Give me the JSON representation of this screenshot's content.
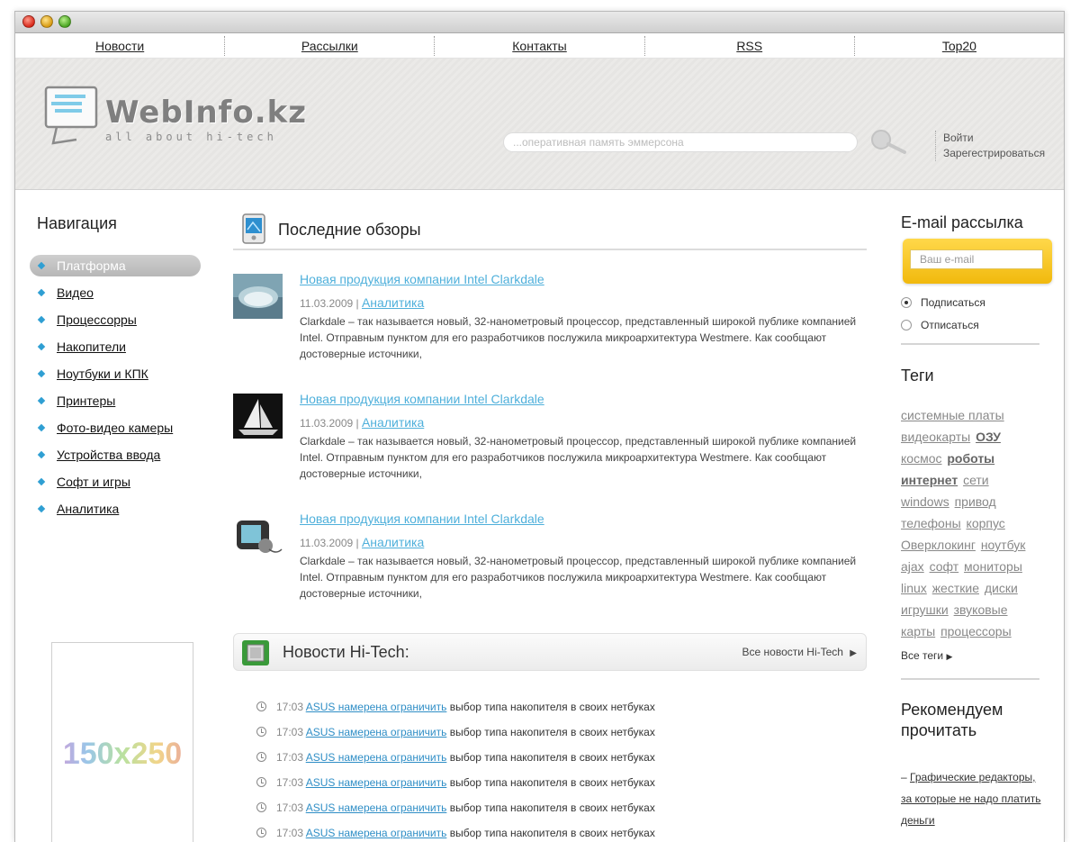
{
  "topnav": {
    "items": [
      "Новости",
      "Рассылки",
      "Контакты",
      "RSS",
      "Top20"
    ]
  },
  "header": {
    "logo_text": "WebInfo.kz",
    "logo_tagline": "all about hi-tech",
    "search_placeholder": "...оперативная память эммерсона",
    "auth": {
      "login": "Войти",
      "register": "Зарегестрироваться"
    }
  },
  "left": {
    "title": "Навигация",
    "items": [
      "Платформа",
      "Видео",
      "Процессорры",
      "Накопители",
      "Ноутбуки и КПК",
      "Принтеры",
      "Фото-видео камеры",
      "Устройства ввода",
      "Софт и игры",
      "Аналитика"
    ],
    "active_index": 0,
    "ad_text": "150x250"
  },
  "center": {
    "reviews_title": "Последние обзоры",
    "articles": [
      {
        "title": "Новая продукция компании Intel Clarkdale",
        "date": "11.03.2009 |",
        "category": "Аналитика",
        "desc": "Clarkdale – так называется новый, 32-нанометровый процессор, представленный широкой публике компанией Intel. Отправным пунктом для его разработчиков послужила микроархитектура Westmere. Как сообщают достоверные источники,"
      },
      {
        "title": "Новая продукция компании Intel Clarkdale",
        "date": "11.03.2009 |",
        "category": "Аналитика",
        "desc": "Clarkdale – так называется новый, 32-нанометровый процессор, представленный широкой публике компанией Intel. Отправным пунктом для его разработчиков послужила микроархитектура Westmere. Как сообщают достоверные источники,"
      },
      {
        "title": "Новая продукция компании Intel Clarkdale",
        "date": "11.03.2009 |",
        "category": "Аналитика",
        "desc": "Clarkdale – так называется новый, 32-нанометровый процессор, представленный широкой публике компанией Intel. Отправным пунктом для его разработчиков послужила микроархитектура Westmere. Как сообщают достоверные источники,"
      }
    ],
    "news_title": "Новости Hi-Tech:",
    "news_all": "Все новости Hi-Tech",
    "news": [
      {
        "time": "17:03",
        "link": "ASUS намерена ограничить",
        "text": " выбор типа накопителя в своих нетбуках"
      },
      {
        "time": "17:03",
        "link": "ASUS намерена ограничить",
        "text": " выбор типа накопителя в своих нетбуках"
      },
      {
        "time": "17:03",
        "link": "ASUS намерена ограничить",
        "text": " выбор типа накопителя в своих нетбуках"
      },
      {
        "time": "17:03",
        "link": "ASUS намерена ограничить",
        "text": " выбор типа накопителя в своих нетбуках"
      },
      {
        "time": "17:03",
        "link": "ASUS намерена ограничить",
        "text": " выбор типа накопителя в своих нетбуках"
      },
      {
        "time": "17:03",
        "link": "ASUS намерена ограничить",
        "text": " выбор типа накопителя в своих нетбуках"
      }
    ]
  },
  "right": {
    "email_title": "E-mail рассылка",
    "email_placeholder": "Ваш e-mail",
    "subscribe": "Подписаться",
    "unsubscribe": "Отписаться",
    "tags_title": "Теги",
    "tags": [
      {
        "t": "системные платы",
        "b": false
      },
      {
        "t": "видеокарты",
        "b": false
      },
      {
        "t": "ОЗУ",
        "b": true
      },
      {
        "t": "космос",
        "b": false
      },
      {
        "t": "роботы",
        "b": true
      },
      {
        "t": "интернет",
        "b": true
      },
      {
        "t": "сети",
        "b": false
      },
      {
        "t": "windows",
        "b": false
      },
      {
        "t": "привод",
        "b": false
      },
      {
        "t": "телефоны",
        "b": false
      },
      {
        "t": "корпус",
        "b": false
      },
      {
        "t": "Оверклокинг",
        "b": false
      },
      {
        "t": "ноутбук",
        "b": false
      },
      {
        "t": "ajax",
        "b": false
      },
      {
        "t": "софт",
        "b": false
      },
      {
        "t": "мониторы",
        "b": false
      },
      {
        "t": "linux",
        "b": false
      },
      {
        "t": "жесткие",
        "b": false
      },
      {
        "t": "диски",
        "b": false
      },
      {
        "t": "игрушки",
        "b": false
      },
      {
        "t": "звуковые",
        "b": false
      },
      {
        "t": "карты",
        "b": false
      },
      {
        "t": "процессоры",
        "b": false
      }
    ],
    "all_tags": "Все теги",
    "recommend_title": "Рекомендуем прочитать",
    "recommend_prefix": "– ",
    "recommend_link": "Графические редакторы, за которые не надо платить деньги"
  },
  "colors": {
    "accent": "#4fb0db",
    "email_box": "#f5c422",
    "nav_bullet": "#2f9fd3"
  }
}
